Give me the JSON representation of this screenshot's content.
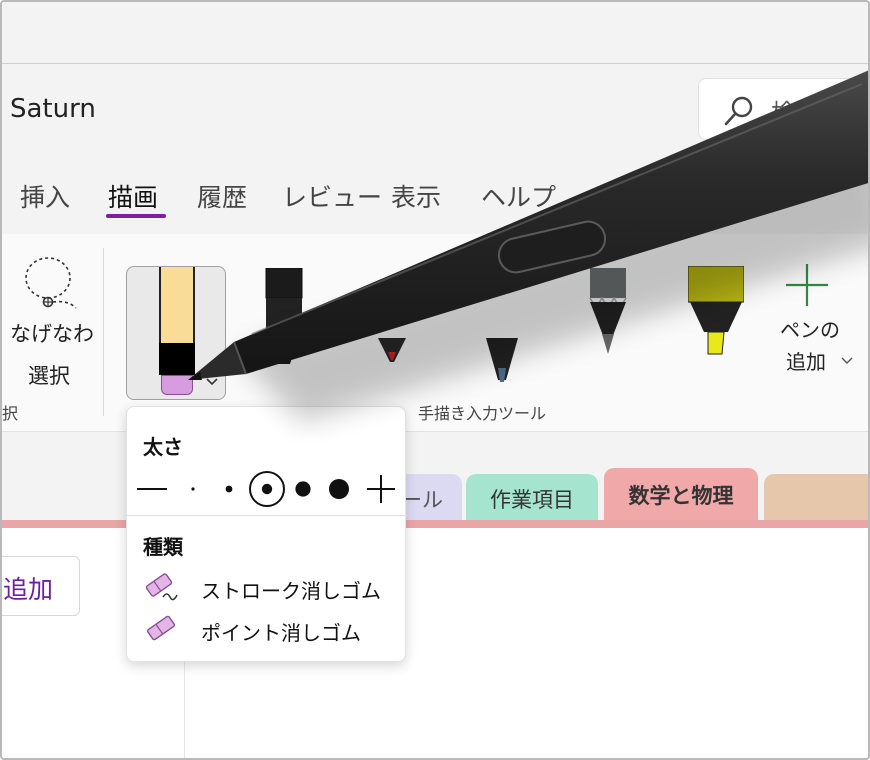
{
  "app": {
    "title": "Saturn"
  },
  "search": {
    "label": "検索"
  },
  "tabs": [
    {
      "label": "挿入",
      "active": false
    },
    {
      "label": "描画",
      "active": true
    },
    {
      "label": "履歴",
      "active": false
    },
    {
      "label": "レビュー",
      "active": false
    },
    {
      "label": "表示",
      "active": false
    },
    {
      "label": "ヘルプ",
      "active": false
    }
  ],
  "ribbon": {
    "lasso": {
      "label_line1": "なげなわ",
      "label_line2": "選択",
      "icon": "lasso-icon"
    },
    "left_group_label": "択",
    "main_group_label": "手描き入力ツール",
    "add_pen": {
      "label_line1": "ペンの",
      "label_line2": "追加",
      "icon": "plus-icon"
    },
    "pens": [
      {
        "name": "black-marker",
        "body": "#1b1b1b",
        "tip": "#1b1b1b"
      },
      {
        "name": "red-pen",
        "body": "#2a2a2a",
        "tip": "#d62828"
      },
      {
        "name": "dark-pen",
        "body": "#222222",
        "tip": "#4c6a8a"
      },
      {
        "name": "gray-pencil",
        "body": "#6b7070",
        "tip": "#2a2a2a"
      },
      {
        "name": "yellow-highlighter",
        "body": "#b5b313",
        "tip": "#e8e81a"
      }
    ]
  },
  "flyout": {
    "thickness_heading": "太さ",
    "type_heading": "種類",
    "items": [
      {
        "label": "ストローク消しゴム",
        "icon": "stroke-eraser-icon"
      },
      {
        "label": "ポイント消しゴム",
        "icon": "point-eraser-icon"
      }
    ]
  },
  "sections": [
    {
      "label": "ール",
      "color": "#dcdaf3",
      "text_color": "#555"
    },
    {
      "label": "作業項目",
      "color": "#a5e5d0",
      "text_color": "#333"
    },
    {
      "label": "数学と物理",
      "color": "#f0a8a8",
      "text_color": "#333"
    },
    {
      "label": "",
      "color": "#e6c7ac",
      "text_color": "#333"
    }
  ],
  "page": {
    "add_label": "追加"
  },
  "colors": {
    "accent": "#7d1ea5",
    "section_accent": "#eaa6a6"
  }
}
